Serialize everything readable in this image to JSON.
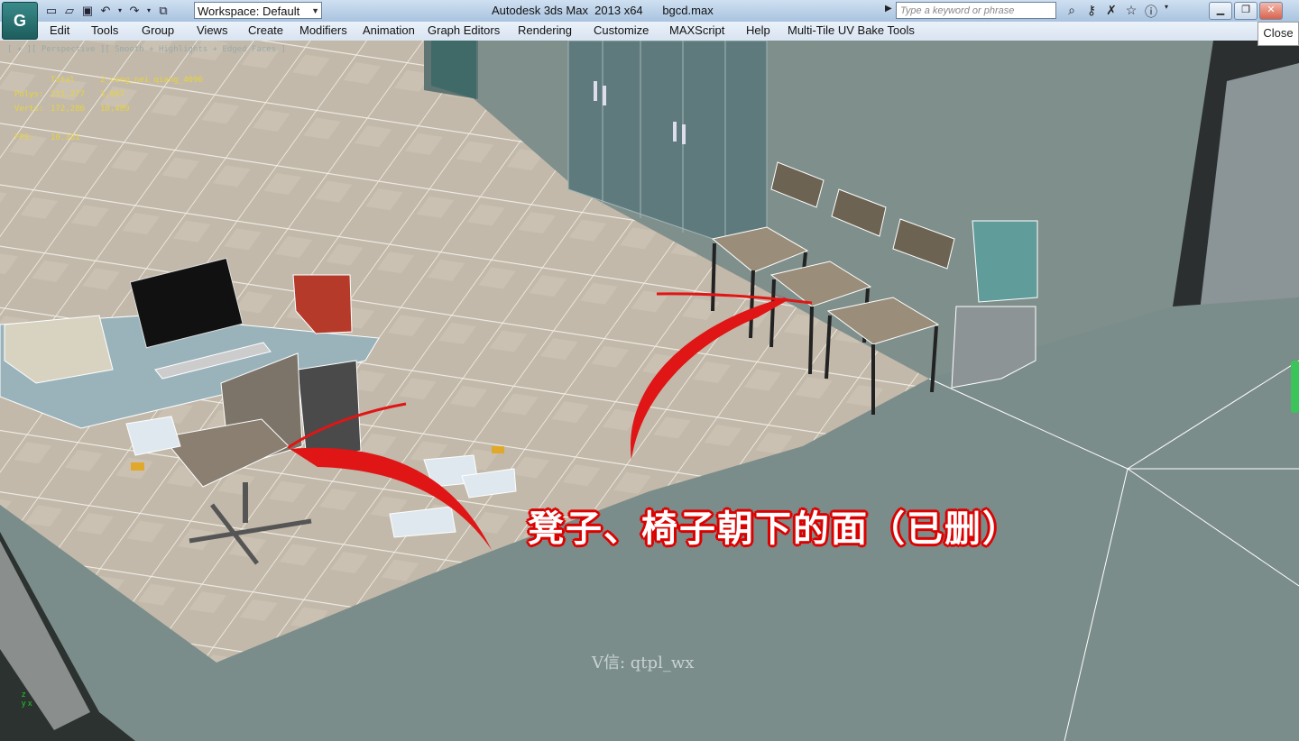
{
  "titlebar": {
    "app_logo": "G",
    "workspace": "Workspace: Default",
    "title": "Autodesk 3ds Max  2013 x64      bgcd.max",
    "search_placeholder": "Type a keyword or phrase",
    "quick_access": [
      "new-icon",
      "open-icon",
      "save-icon",
      "undo-icon",
      "redo-icon",
      "project-icon"
    ],
    "icons": [
      "binoculars-icon",
      "key-icon",
      "community-icon",
      "favorite-icon",
      "help-icon"
    ],
    "window_controls": [
      "minimize",
      "restore",
      "close"
    ]
  },
  "menu": [
    "Edit",
    "Tools",
    "Group",
    "Views",
    "Create",
    "Modifiers",
    "Animation",
    "Graph Editors",
    "Rendering",
    "Customize",
    "MAXScript",
    "Help",
    "Multi-Tile UV Bake Tools"
  ],
  "close_tooltip": "Close",
  "viewport": {
    "label": "[ + ][ Perspective ][ Smooth + Highlights + Edged Faces ]",
    "stats": {
      "header_total": "Total",
      "header_object": "2_ceng_nei_qiang_4096",
      "polys_label": "Polys:",
      "polys_total": "211,277",
      "polys_object": "3,087",
      "verts_label": "Verts:",
      "verts_total": "172,286",
      "verts_object": "10,489",
      "fps_label": "FPS:",
      "fps_value": "10.331"
    },
    "annotation": "凳子、椅子朝下的面（已删）",
    "watermark": "V信: qtpl_wx",
    "axis": "z\ny x"
  },
  "colors": {
    "floor": "#bfb7a9",
    "wall": "#7f908d",
    "cabinet": "#607a7c",
    "arrow": "#e01515",
    "stats": "#e6d43c"
  }
}
